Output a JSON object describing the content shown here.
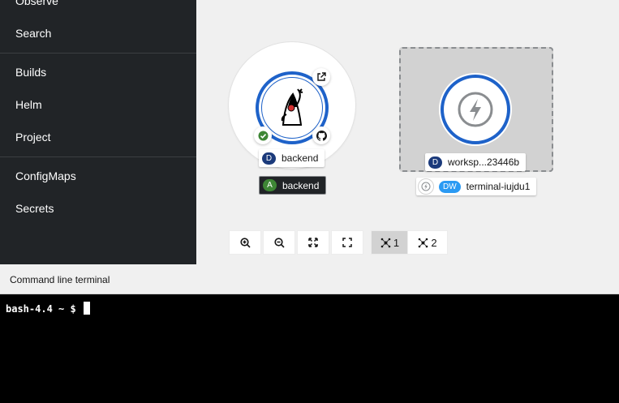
{
  "sidebar": {
    "items": [
      {
        "label": "Observe"
      },
      {
        "label": "Search"
      },
      {
        "label": "Builds"
      },
      {
        "label": "Helm"
      },
      {
        "label": "Project"
      },
      {
        "label": "ConfigMaps"
      },
      {
        "label": "Secrets"
      }
    ]
  },
  "topology": {
    "backend_node": {
      "deployment_badge": "D",
      "deployment_name": "backend",
      "app_badge": "A",
      "app_name": "backend",
      "status_icon": "check-circle-icon",
      "source_icon": "github-icon",
      "link_icon": "external-link-icon"
    },
    "workspace_group": {
      "deployment_badge": "D",
      "deployment_name": "worksp...23446b",
      "group_badge": "DW",
      "group_name": "terminal-iujdu1",
      "icon": "lightning-bolt-icon"
    }
  },
  "toolbar": {
    "buttons": [
      {
        "name": "zoom-in",
        "icon": "zoom-in-icon"
      },
      {
        "name": "zoom-out",
        "icon": "zoom-out-icon"
      },
      {
        "name": "fit-to-screen",
        "icon": "expand-arrows-icon"
      },
      {
        "name": "reset-view",
        "icon": "fullscreen-icon"
      }
    ],
    "layout1_label": "1",
    "layout2_label": "2"
  },
  "terminal": {
    "title": "Command line terminal",
    "prompt": "bash-4.4 ~ $ "
  },
  "colors": {
    "sidebar_bg": "#212427",
    "ring_blue": "#1e62c9",
    "success_green": "#3e8635",
    "dw_badge": "#2b9af3"
  }
}
